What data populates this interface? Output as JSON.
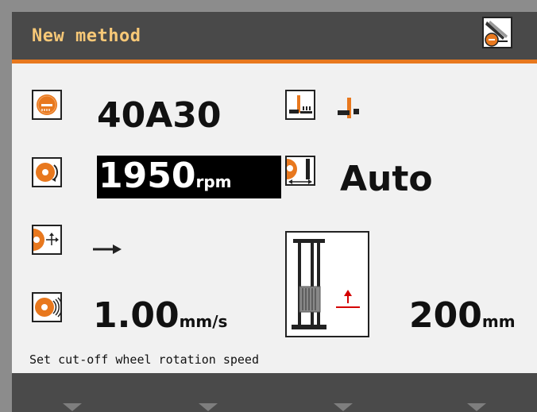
{
  "header": {
    "title": "New method",
    "status_icon": "cut-off-wheel-status-icon"
  },
  "settings": {
    "wheel_type": "40A30",
    "rotation_speed_value": "1950",
    "rotation_speed_unit": "rpm",
    "feed_mode": "Auto",
    "cut_direction_icon": "arrow-right-icon",
    "feed_speed_value": "1.00",
    "feed_speed_unit": "mm/s",
    "cut_length_value": "200",
    "cut_length_unit": "mm"
  },
  "hint_text": "Set cut-off wheel rotation speed",
  "softkeys": [
    "softkey-1",
    "softkey-2",
    "softkey-3",
    "softkey-4"
  ],
  "colors": {
    "accent": "#e8781e",
    "title": "#f7c877",
    "highlight_bg": "#000000",
    "diagram_arrow": "#d40000"
  }
}
